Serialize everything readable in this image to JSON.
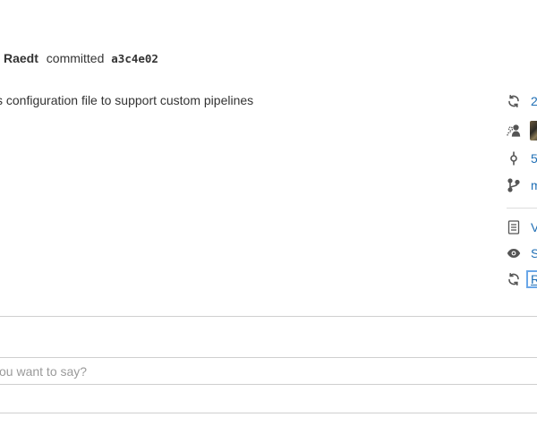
{
  "commit": {
    "author": "Raedt",
    "verb": "committed",
    "hash": "a3c4e02",
    "message": "s configuration file to support custom pipelines"
  },
  "sidebar": {
    "items": [
      {
        "icon": "sync-icon",
        "label": "2"
      },
      {
        "icon": "reviewers-icon",
        "label": ""
      },
      {
        "icon": "commit-icon",
        "label": "5"
      },
      {
        "icon": "branch-icon",
        "label": "m"
      },
      {
        "icon": "document-icon",
        "label": "V"
      },
      {
        "icon": "eye-icon",
        "label": "S"
      },
      {
        "icon": "sync-icon",
        "label": "R"
      }
    ]
  },
  "comment": {
    "placeholder": "you want to say?",
    "value": ""
  }
}
